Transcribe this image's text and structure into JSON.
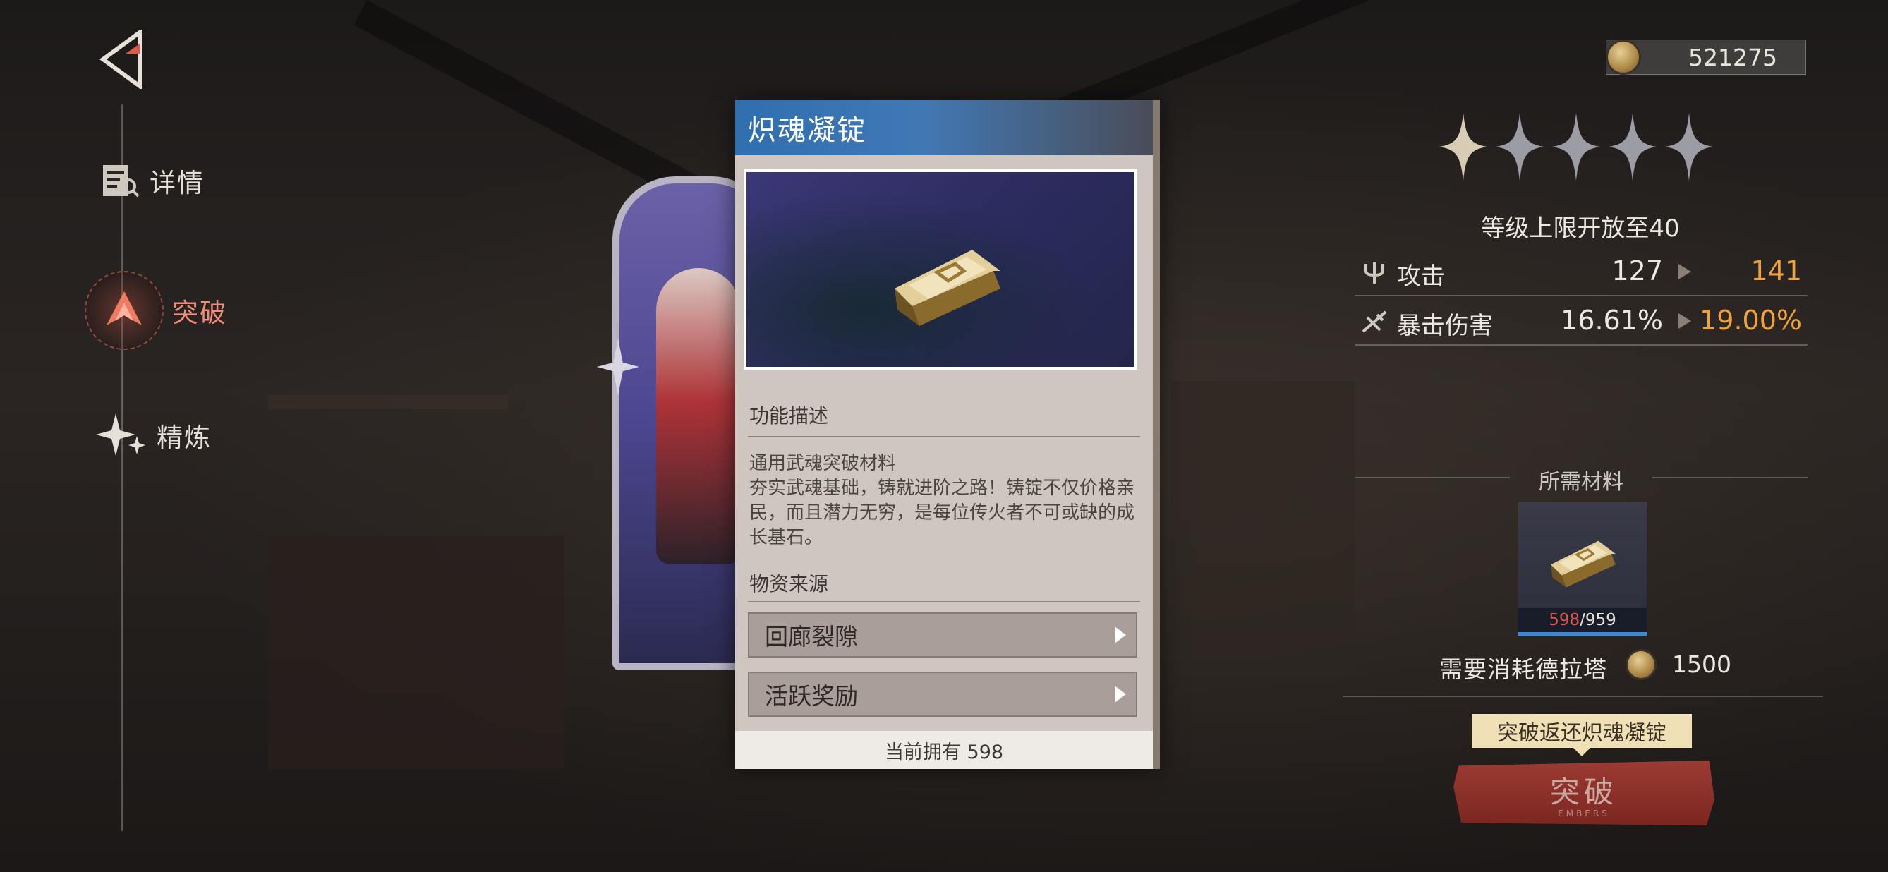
{
  "nav": {
    "items": [
      {
        "label": "详情",
        "icon": "details-icon",
        "active": false
      },
      {
        "label": "突破",
        "icon": "breakthrough-icon",
        "active": true
      },
      {
        "label": "精炼",
        "icon": "refine-icon",
        "active": false
      }
    ]
  },
  "popup": {
    "title": "炽魂凝锭",
    "function_title": "功能描述",
    "description_line1": "通用武魂突破材料",
    "description_line2": "夯实武魂基础，铸就进阶之路！铸锭不仅价格亲民，而且潜力无穷，是每位传火者不可或缺的成长基石。",
    "source_title": "物资来源",
    "sources": [
      "回廊裂隙",
      "活跃奖励"
    ],
    "footer": "当前拥有 598"
  },
  "currency": {
    "amount": "521275"
  },
  "stars": {
    "total": 5,
    "filled": 1
  },
  "cap_text": "等级上限开放至40",
  "stats": [
    {
      "label": "攻击",
      "icon": "trident-icon",
      "old": "127",
      "new": "141"
    },
    {
      "label": "暴击伤害",
      "icon": "crit-damage-icon",
      "old": "16.61%",
      "new": "19.00%"
    }
  ],
  "materials": {
    "title": "所需材料",
    "owned": "598",
    "required": "/959"
  },
  "consume": {
    "label": "需要消耗德拉塔",
    "amount": "1500"
  },
  "tooltip": "突破返还炽魂凝锭",
  "break_button": {
    "label": "突破",
    "sub": "EMBERS"
  },
  "colors": {
    "accent_orange": "#f0a23a",
    "nav_active": "#ef8d7a",
    "insufficient": "#e0544a",
    "popup_header": "#2f6fb0"
  }
}
